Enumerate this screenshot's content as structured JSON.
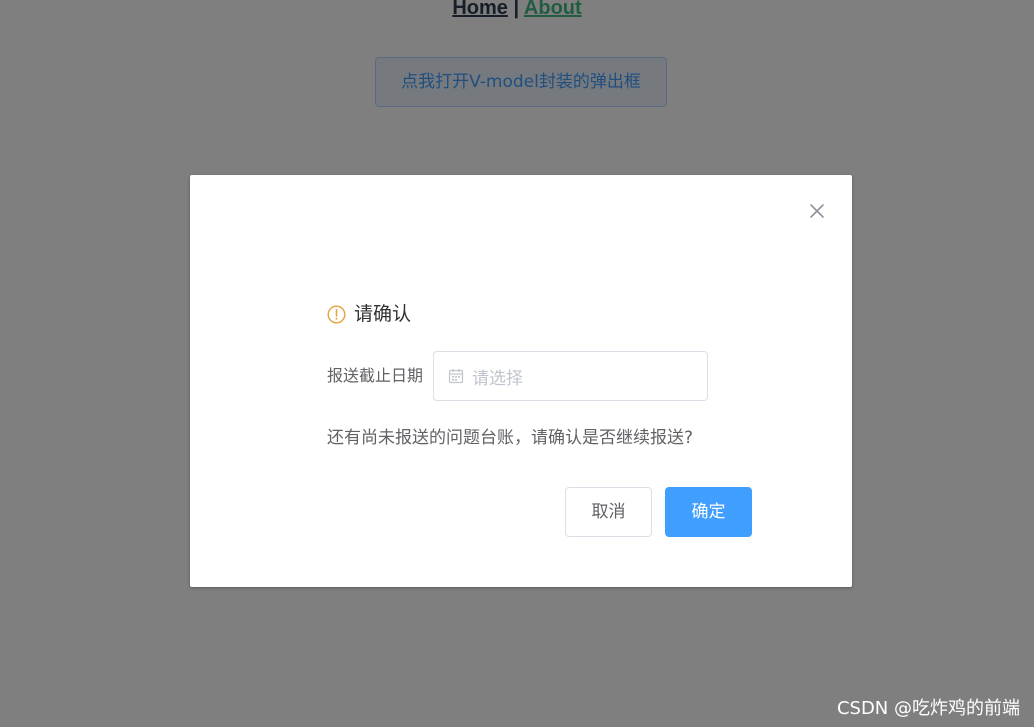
{
  "nav": {
    "home_label": "Home",
    "separator": "|",
    "about_label": "About"
  },
  "page": {
    "open_button_label": "点我打开V-model封装的弹出框"
  },
  "dialog": {
    "close_icon": "close-icon",
    "warning_icon": "warning-circle-icon",
    "title": "请确认",
    "field_label": "报送截止日期",
    "date_icon": "calendar-icon",
    "date_placeholder": "请选择",
    "message": "还有尚未报送的问题台账，请确认是否继续报送?",
    "cancel_label": "取消",
    "confirm_label": "确定"
  },
  "watermark": {
    "text": "CSDN @吃炸鸡的前端"
  },
  "colors": {
    "primary": "#409eff",
    "warning": "#e6a23c",
    "nav_home": "#2c3e50",
    "nav_about": "#42b983",
    "overlay": "rgba(0,0,0,0.5)"
  }
}
